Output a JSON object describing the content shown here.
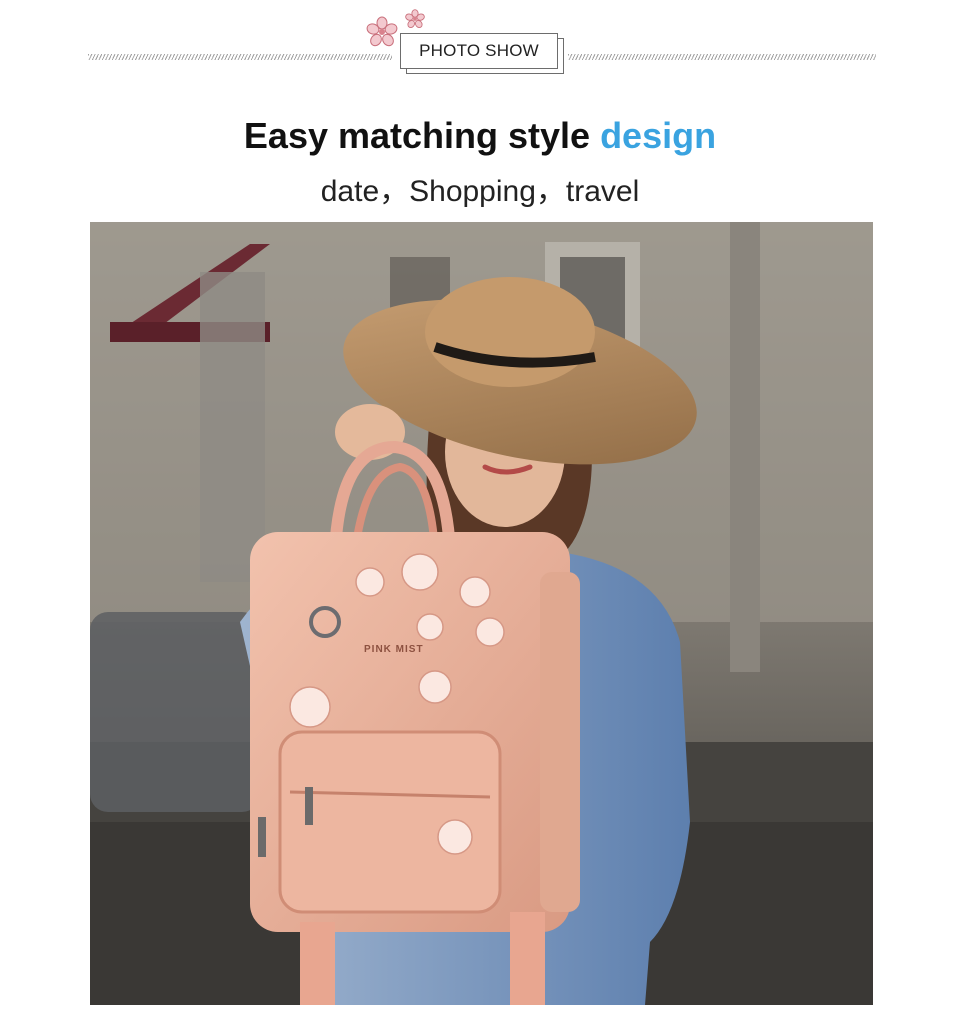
{
  "header": {
    "badge_label": "PHOTO SHOW",
    "ornament_icon": "cherry-blossom-icon"
  },
  "headline": {
    "main": "Easy matching style ",
    "accent": "design",
    "accent_color": "#3aa3e0"
  },
  "subline": "date，Shopping，travel",
  "photo": {
    "bag_brand": "PINK MIST",
    "description_icon": "woman-with-pink-backpack-photo"
  }
}
